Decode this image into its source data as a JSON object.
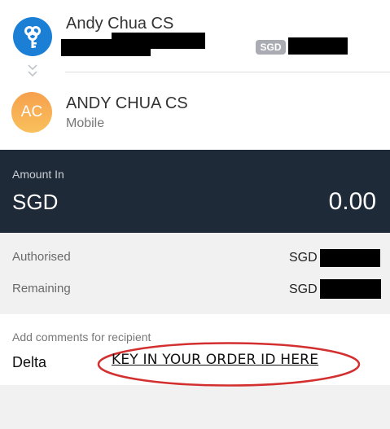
{
  "from_account": {
    "name": "Andy Chua CS",
    "currency_badge": "SGD",
    "icon": "bank-key-icon"
  },
  "to_account": {
    "avatar_initials": "AC",
    "name": "ANDY CHUA CS",
    "subtitle": "Mobile"
  },
  "amount": {
    "label": "Amount In",
    "currency": "SGD",
    "value": "0.00"
  },
  "limits": {
    "authorised_label": "Authorised",
    "authorised_currency": "SGD",
    "remaining_label": "Remaining",
    "remaining_currency": "SGD"
  },
  "comments": {
    "label": "Add comments for recipient",
    "value": "Delta"
  },
  "annotation": {
    "text": "KEY IN YOUR ORDER ID HERE",
    "color": "#d32f2f"
  },
  "colors": {
    "bank_blue": "#1b7fd6",
    "panel_dark": "#1e2a38",
    "avatar_orange": "#f6a04d"
  }
}
